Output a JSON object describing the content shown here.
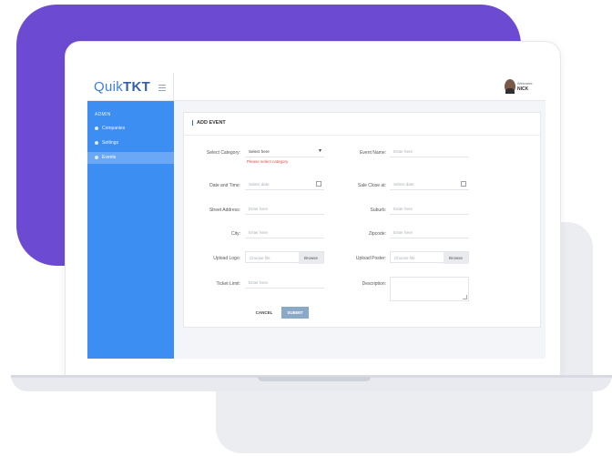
{
  "brand": {
    "name_prefix": "Quik",
    "name_suffix": "TKT"
  },
  "user": {
    "welcome": "Welcome",
    "name": "NICK"
  },
  "sidebar": {
    "header": "ADMIN",
    "items": [
      {
        "label": "Companies",
        "icon": "building-icon",
        "active": false
      },
      {
        "label": "Settings",
        "icon": "gear-icon",
        "active": false
      },
      {
        "label": "Events",
        "icon": "calendar-icon",
        "active": true
      }
    ]
  },
  "form": {
    "title": "ADD EVENT",
    "category": {
      "label": "Select Category:",
      "value": "Select here",
      "error": "Please select category"
    },
    "event_name": {
      "label": "Event Name:",
      "placeholder": "Enter here"
    },
    "date_time": {
      "label": "Date and Time:",
      "placeholder": "Select date"
    },
    "sale_close": {
      "label": "Sale Close at:",
      "placeholder": "Select date"
    },
    "street": {
      "label": "Street Address:",
      "placeholder": "Enter here"
    },
    "suburb": {
      "label": "Suburb:",
      "placeholder": "Enter here"
    },
    "city": {
      "label": "City:",
      "placeholder": "Enter here"
    },
    "zipcode": {
      "label": "Zipcode:",
      "placeholder": "Enter here"
    },
    "logo": {
      "label": "Upload Logo:",
      "placeholder": "Choose file",
      "browse": "Browse"
    },
    "poster": {
      "label": "Upload Poster:",
      "placeholder": "Choose file",
      "browse": "Browse"
    },
    "ticket_limit": {
      "label": "Ticket Limit:",
      "placeholder": "Enter here"
    },
    "description": {
      "label": "Description:"
    },
    "cancel": "CANCEL",
    "submit": "SUBMIT"
  },
  "colors": {
    "accent": "#3d8ef2",
    "brand_bg": "#6c4bd2",
    "error": "#e24b4b",
    "submit": "#8aa9c6"
  }
}
